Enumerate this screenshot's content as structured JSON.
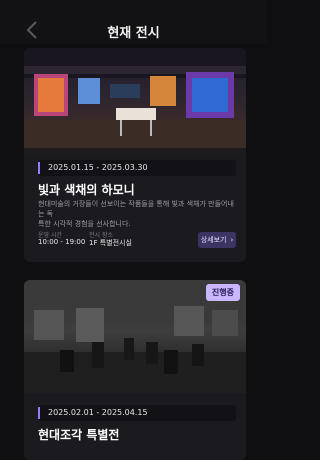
{
  "header": {
    "title": "현재 전시"
  },
  "exhibitions": [
    {
      "date_range": "2025.01.15 - 2025.03.30",
      "title": "빛과 색채의 하모니",
      "description_lines": [
        "현대미술의 거장들이 선보이는 작품들을 통해 빛과 색채가 만들어내는 독",
        "특한 시각적 경험을 선사합니다."
      ],
      "hours_label": "운영 시간",
      "hours_value": "10:00 - 19:00",
      "location_label": "전시 장소",
      "location_value": "1F 특별전시실",
      "detail_button": "상세보기"
    },
    {
      "badge": "진행중",
      "date_range": "2025.02.01 - 2025.04.15",
      "title": "현대조각 특별전"
    }
  ]
}
